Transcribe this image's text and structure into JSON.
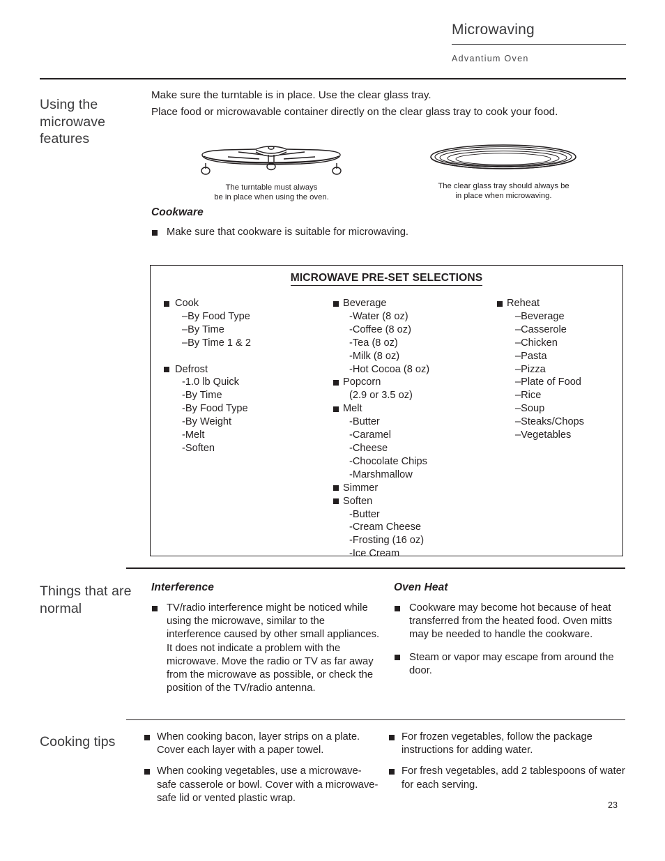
{
  "header": {
    "title": "Microwaving",
    "subtitle": "Advantium Oven"
  },
  "sections": {
    "using_microwave": {
      "gutter_label": "Using the microwave features",
      "intro_line_1": "Make sure the turntable is in place. Use the clear glass tray.",
      "intro_line_2": "Place food or microwavable container directly on the clear glass tray to cook your food.",
      "figures": [
        {
          "name": "turntable",
          "caption_line_1": "The turntable must always",
          "caption_line_2": "be in place when using the oven."
        },
        {
          "name": "glass-tray",
          "caption_line_1": "The clear glass tray should always be",
          "caption_line_2": "in place when microwaving."
        }
      ],
      "cookware": {
        "heading": "Cookware",
        "bullets": [
          "Make sure that cookware is suitable for microwaving."
        ]
      }
    },
    "preset_selections": {
      "title": "MICROWAVE PRE-SET SELECTIONS",
      "columns": [
        {
          "groups": [
            {
              "name": "Cook",
              "items": [
                "–By Food Type",
                "–By Time",
                "–By Time 1 & 2"
              ],
              "gap_after": true
            },
            {
              "name": "Defrost",
              "items": [
                "-1.0 lb Quick",
                "-By Time",
                "-By Food Type",
                "-By Weight",
                "-Melt",
                "-Soften"
              ],
              "gap_after": false
            }
          ]
        },
        {
          "groups": [
            {
              "name": "Beverage",
              "items": [
                "-Water (8 oz)",
                "-Coffee (8 oz)",
                "-Tea (8 oz)",
                "-Milk (8 oz)",
                "-Hot Cocoa (8 oz)"
              ],
              "gap_after": false
            },
            {
              "name": "Popcorn",
              "items": [
                "(2.9 or 3.5 oz)"
              ],
              "gap_after": false
            },
            {
              "name": "Melt",
              "items": [
                "-Butter",
                "-Caramel",
                "-Cheese",
                "-Chocolate Chips",
                "-Marshmallow"
              ],
              "gap_after": false
            },
            {
              "name": "Simmer",
              "items": [],
              "gap_after": false
            },
            {
              "name": "Soften",
              "items": [
                "-Butter",
                "-Cream Cheese",
                "-Frosting (16 oz)",
                "-Ice Cream"
              ],
              "gap_after": false
            }
          ]
        },
        {
          "groups": [
            {
              "name": "Reheat",
              "items": [
                "–Beverage",
                "–Casserole",
                "–Chicken",
                "–Pasta",
                "–Pizza",
                "–Plate of Food",
                "–Rice",
                "–Soup",
                "–Steaks/Chops",
                "–Vegetables"
              ],
              "gap_after": false
            }
          ]
        }
      ]
    },
    "things_normal": {
      "gutter_label": "Things that are normal",
      "left": {
        "heading": "Interference",
        "bullets": [
          "TV/radio interference might be noticed while using the microwave, similar to the interference caused by other small appliances. It does not indicate a problem with the microwave. Move the radio or TV as far away from the microwave as possible, or check the position of the TV/radio antenna."
        ]
      },
      "right": {
        "heading": "Oven Heat",
        "bullets": [
          "Cookware may become hot because of heat transferred from the heated food. Oven mitts may be needed to handle the cookware.",
          "Steam or vapor may escape from around the door."
        ]
      }
    },
    "cooking_tips": {
      "gutter_label": "Cooking tips",
      "left_bullets": [
        "When cooking bacon, layer strips on a plate. Cover each layer with a paper towel.",
        "When cooking vegetables, use a microwave-safe casserole or bowl. Cover with a microwave-safe lid or vented plastic wrap."
      ],
      "right_bullets": [
        "For frozen vegetables, follow the package instructions for adding water.",
        "For fresh vegetables, add 2 tablespoons of water for each serving."
      ]
    }
  },
  "footer": {
    "page_number": "23"
  },
  "colors": {
    "text": "#231f20",
    "header_text": "#3a3a3c",
    "rule": "#231f20"
  }
}
